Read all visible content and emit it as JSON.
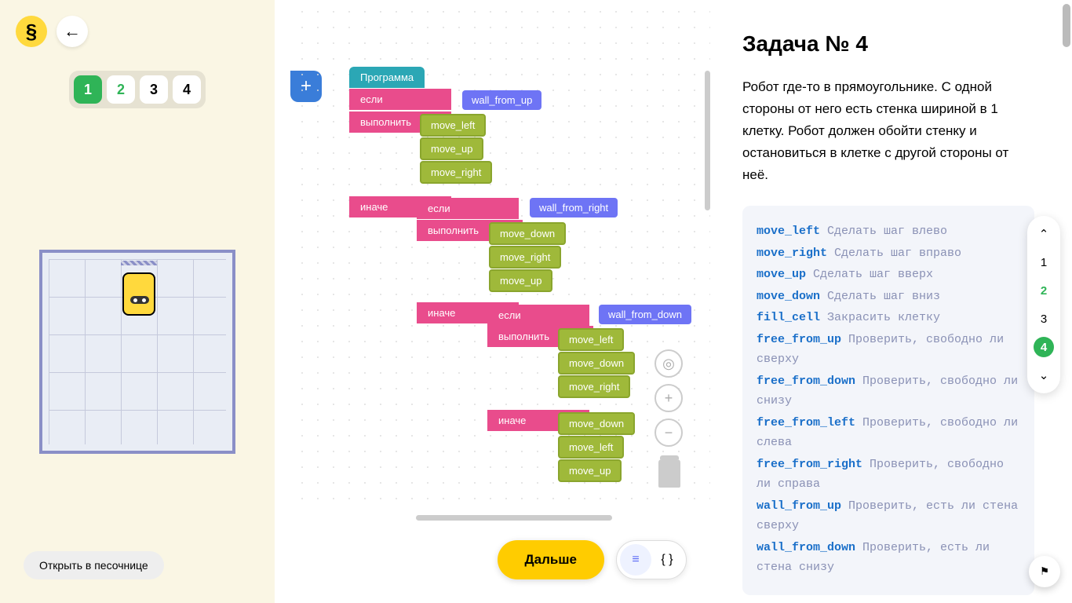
{
  "header": {
    "logo_symbol": "§",
    "task_tabs": [
      "1",
      "2",
      "3",
      "4"
    ],
    "active_tab_index": 0
  },
  "sandbox_button": "Открыть в песочнице",
  "add_button_symbol": "+",
  "blocks": {
    "program": "Программа",
    "if": "если",
    "do": "выполнить",
    "else": "иначе",
    "wall_from_up": "wall_from_up",
    "wall_from_right": "wall_from_right",
    "wall_from_down": "wall_from_down",
    "move_left": "move_left",
    "move_up": "move_up",
    "move_right": "move_right",
    "move_down": "move_down"
  },
  "next_button": "Дальше",
  "view_toggle": {
    "blocks_icon": "≡",
    "code_icon": "{ }"
  },
  "task": {
    "title": "Задача № 4",
    "description": "Робот где-то в прямоугольнике. С одной стороны от него есть стенка шириной в 1 клетку. Робот должен обойти стенку и остановиться в клетке с другой стороны от неё."
  },
  "commands": [
    {
      "name": "move_left",
      "desc": "Сделать шаг влево"
    },
    {
      "name": "move_right",
      "desc": "Сделать шаг вправо"
    },
    {
      "name": "move_up",
      "desc": "Сделать шаг вверх"
    },
    {
      "name": "move_down",
      "desc": "Сделать шаг вниз"
    },
    {
      "name": "fill_cell",
      "desc": "Закрасить клетку"
    },
    {
      "name": "free_from_up",
      "desc": "Проверить, свободно ли сверху"
    },
    {
      "name": "free_from_down",
      "desc": "Проверить, свободно ли снизу"
    },
    {
      "name": "free_from_left",
      "desc": "Проверить, свободно ли слева"
    },
    {
      "name": "free_from_right",
      "desc": "Проверить, свободно ли справа"
    },
    {
      "name": "wall_from_up",
      "desc": "Проверить, есть ли стена сверху"
    },
    {
      "name": "wall_from_down",
      "desc": "Проверить, есть ли стена снизу"
    }
  ],
  "side_nav": {
    "items": [
      "1",
      "2",
      "3",
      "4"
    ],
    "active_index": 3,
    "done_indices": [
      1
    ]
  },
  "icons": {
    "up": "⌃",
    "down": "⌄",
    "flag": "⚑",
    "target": "◎",
    "back": "←"
  }
}
